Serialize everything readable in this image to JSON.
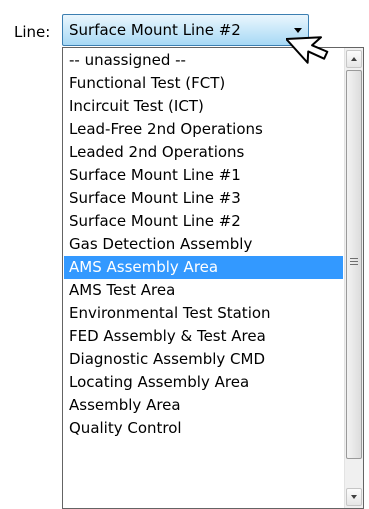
{
  "form": {
    "line_label": "Line:",
    "selected_value": "Surface Mount Line #2"
  },
  "dropdown": {
    "options": [
      "-- unassigned --",
      "Functional Test (FCT)",
      "Incircuit Test (ICT)",
      "Lead-Free 2nd Operations",
      "Leaded 2nd Operations",
      "Surface Mount Line #1",
      "Surface Mount Line #3",
      "Surface Mount Line #2",
      "Gas Detection Assembly",
      "AMS Assembly Area",
      "AMS Test Area",
      "Environmental Test Station",
      "FED Assembly & Test Area",
      "Diagnostic Assembly CMD",
      "Locating Assembly Area",
      "Assembly Area",
      "Quality Control"
    ],
    "highlighted_option": "AMS Assembly Area"
  },
  "colors": {
    "highlight": "#3399ff",
    "select_border": "#3c7fb1"
  },
  "icons": {
    "dropdown_arrow": "caret-down-icon",
    "cursor": "mouse-pointer-icon"
  }
}
